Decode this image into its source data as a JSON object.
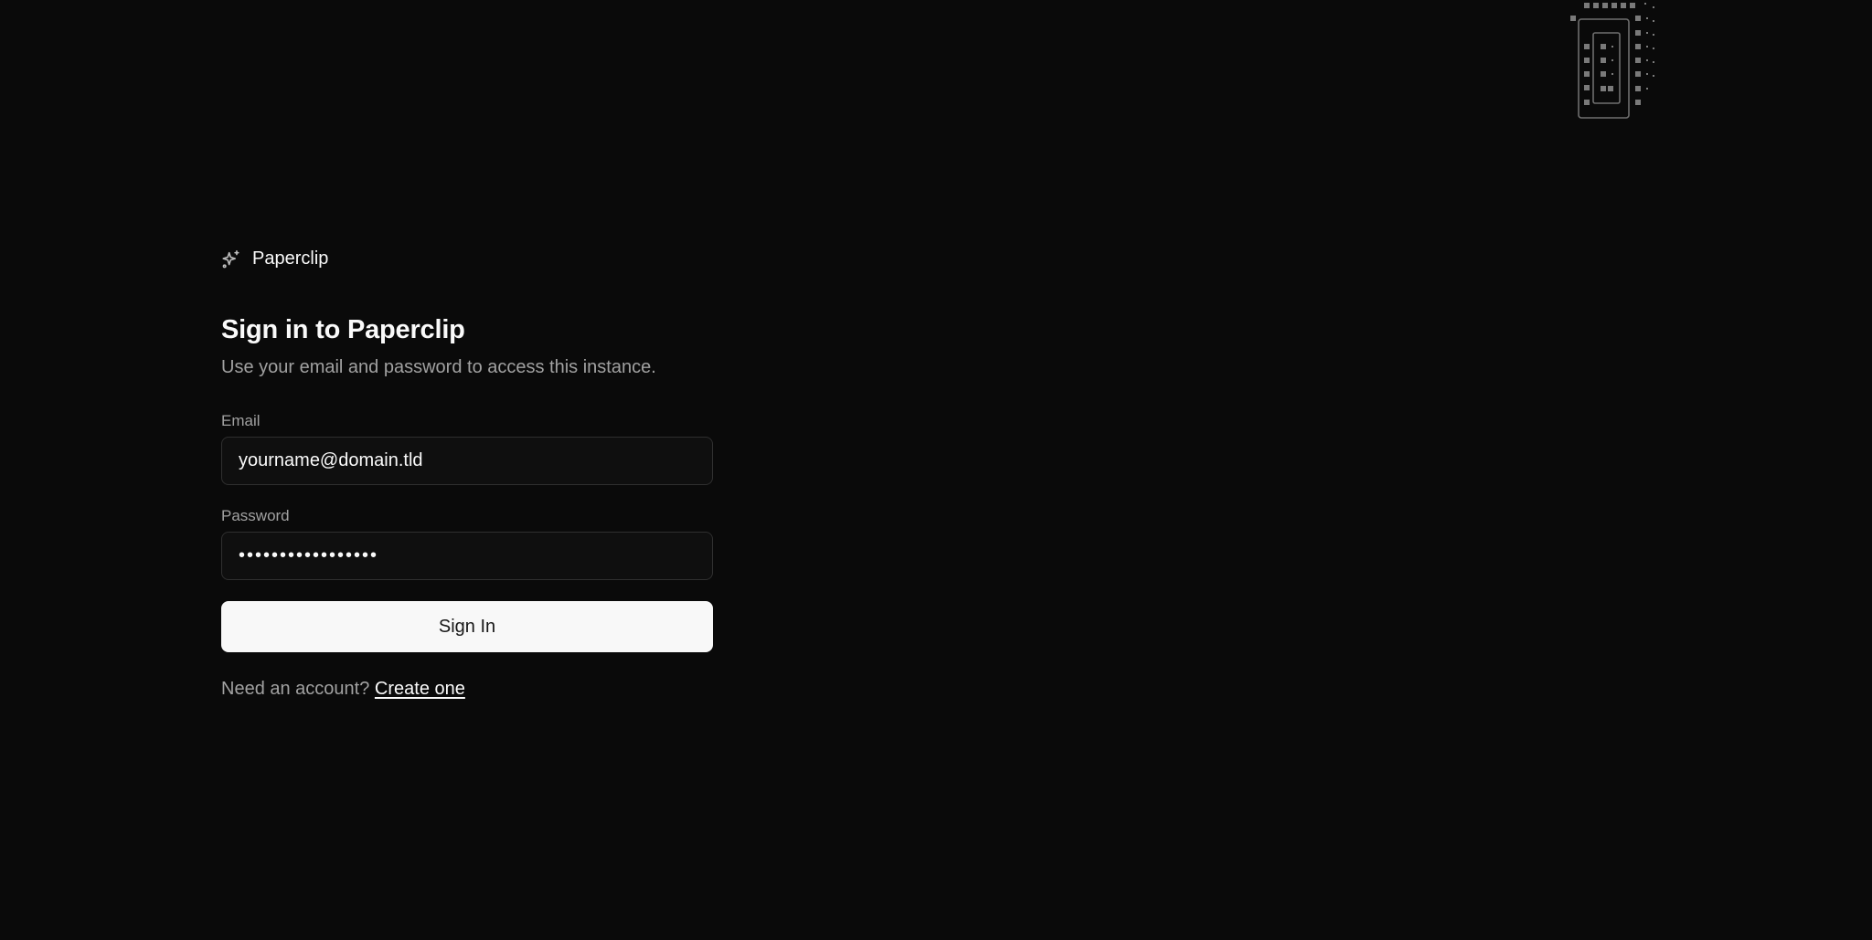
{
  "brand": {
    "name": "Paperclip",
    "icon": "sparkles-icon"
  },
  "heading": {
    "title": "Sign in to Paperclip",
    "subtitle": "Use your email and password to access this instance."
  },
  "form": {
    "email_label": "Email",
    "email_value": "yourname@domain.tld",
    "password_label": "Password",
    "password_value": "•••••••••••••••••",
    "submit_label": "Sign In"
  },
  "footer": {
    "prompt": "Need an account?",
    "link_label": "Create one"
  },
  "colors": {
    "background": "#0a0a0a",
    "button_bg": "#f8f8f8",
    "muted_text": "#a1a1a1"
  }
}
